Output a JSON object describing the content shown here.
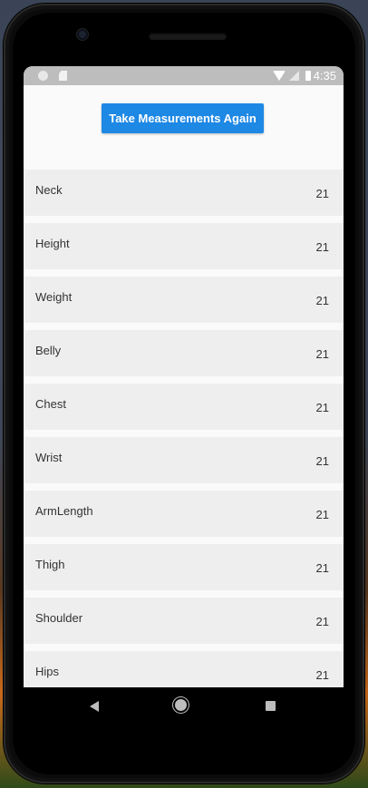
{
  "status_bar": {
    "time": "4:35",
    "icons": [
      "circle-icon",
      "sd-card-icon",
      "wifi-icon",
      "signal-icon",
      "battery-icon"
    ]
  },
  "header": {
    "button_label": "Take Measurements Again"
  },
  "measurements": [
    {
      "label": "Neck",
      "value": "21"
    },
    {
      "label": "Height",
      "value": "21"
    },
    {
      "label": "Weight",
      "value": "21"
    },
    {
      "label": "Belly",
      "value": "21"
    },
    {
      "label": "Chest",
      "value": "21"
    },
    {
      "label": "Wrist",
      "value": "21"
    },
    {
      "label": "ArmLength",
      "value": "21"
    },
    {
      "label": "Thigh",
      "value": "21"
    },
    {
      "label": "Shoulder",
      "value": "21"
    },
    {
      "label": "Hips",
      "value": "21"
    }
  ],
  "nav_bar": {
    "icons": [
      "back-icon",
      "home-icon",
      "recents-icon"
    ]
  },
  "colors": {
    "accent": "#1e88e5",
    "status_bar": "#bdbdbd",
    "list_item_bg": "#eeeeee",
    "screen_bg": "#fafafa"
  }
}
